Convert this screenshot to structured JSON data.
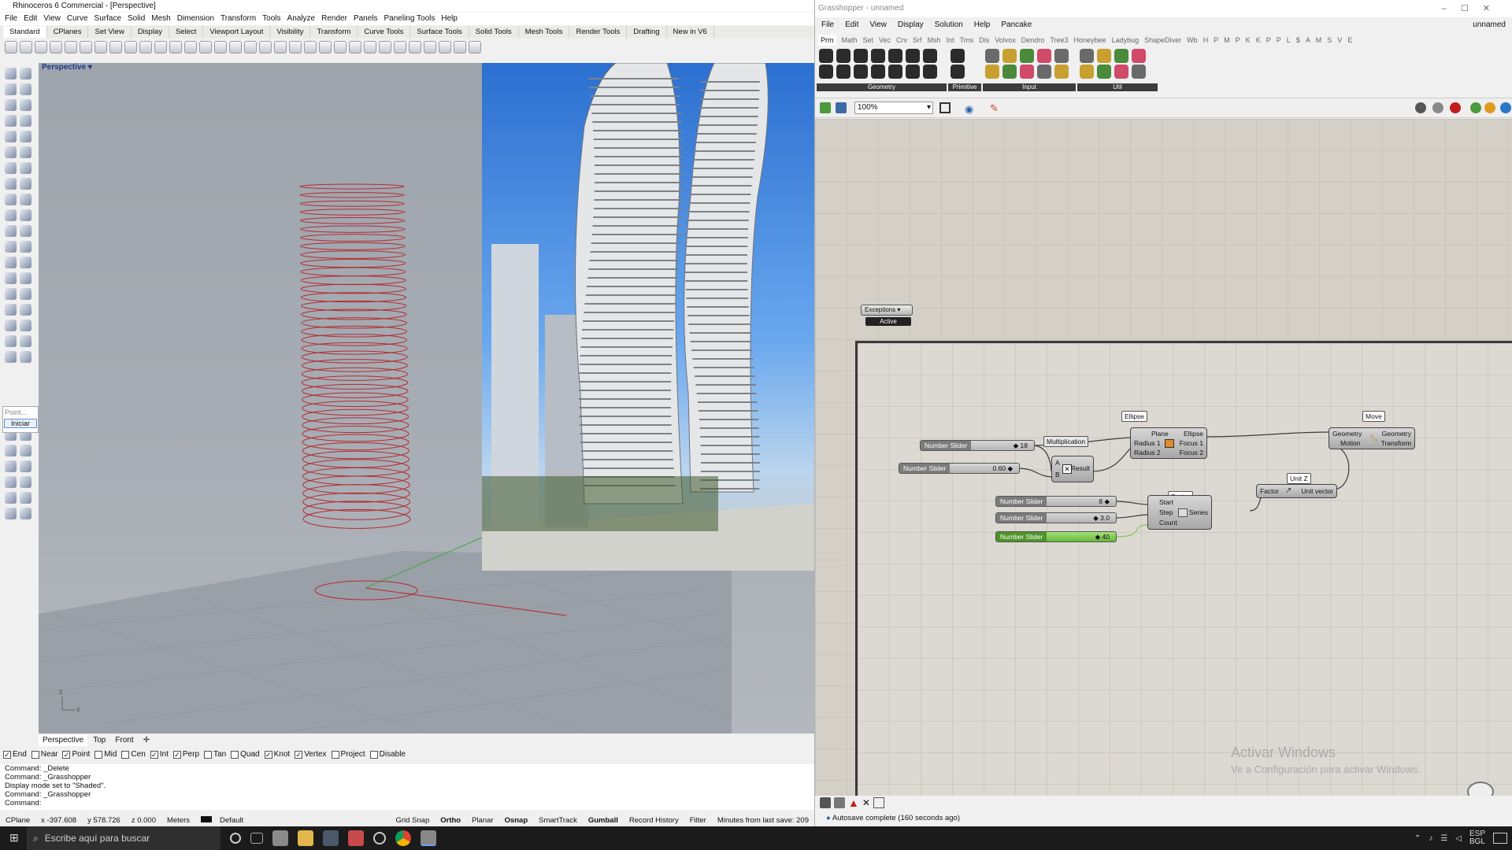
{
  "rhino": {
    "title": "Rhinoceros 6 Commercial - [Perspective]",
    "menus": [
      "File",
      "Edit",
      "View",
      "Curve",
      "Surface",
      "Solid",
      "Mesh",
      "Dimension",
      "Transform",
      "Tools",
      "Analyze",
      "Render",
      "Panels",
      "Paneling Tools",
      "Help"
    ],
    "tabs": [
      "Standard",
      "CPlanes",
      "Set View",
      "Display",
      "Select",
      "Viewport Layout",
      "Visibility",
      "Transform",
      "Curve Tools",
      "Surface Tools",
      "Solid Tools",
      "Mesh Tools",
      "Render Tools",
      "Drafting",
      "New in V6"
    ],
    "viewport_label": "Perspective",
    "viewport_tabs": [
      "Perspective",
      "Top",
      "Front"
    ],
    "side_popup": [
      "Point...",
      "Iniciar"
    ],
    "osnaps": [
      {
        "label": "End",
        "checked": true
      },
      {
        "label": "Near",
        "checked": false
      },
      {
        "label": "Point",
        "checked": true
      },
      {
        "label": "Mid",
        "checked": false
      },
      {
        "label": "Cen",
        "checked": false
      },
      {
        "label": "Int",
        "checked": true
      },
      {
        "label": "Perp",
        "checked": true
      },
      {
        "label": "Tan",
        "checked": false
      },
      {
        "label": "Quad",
        "checked": false
      },
      {
        "label": "Knot",
        "checked": true
      },
      {
        "label": "Vertex",
        "checked": true
      },
      {
        "label": "Project",
        "checked": false
      },
      {
        "label": "Disable",
        "checked": false
      }
    ],
    "command_history": [
      "Command: _Delete",
      "Command: _Grasshopper",
      "Display mode set to \"Shaded\".",
      "Command: _Grasshopper",
      "Command:"
    ],
    "status": {
      "cplane": "CPlane",
      "x": "x -397.608",
      "y": "y 578.726",
      "z": "z 0.000",
      "units": "Meters",
      "layer": "Default",
      "toggles": [
        "Grid Snap",
        "Ortho",
        "Planar",
        "Osnap",
        "SmartTrack",
        "Gumball",
        "Record History",
        "Filter"
      ],
      "save": "Minutes from last save: 209"
    }
  },
  "gh": {
    "title": "Grasshopper - unnamed",
    "menus": [
      "File",
      "Edit",
      "View",
      "Display",
      "Solution",
      "Help",
      "Pancake"
    ],
    "doc_name": "unnamed",
    "tabs": [
      "Prm",
      "Math",
      "Set",
      "Vec",
      "Crv",
      "Srf",
      "Msh",
      "Int",
      "Trns",
      "Dis",
      "Volvox",
      "Dendro",
      "Tree3",
      "Honeybee",
      "Ladybug",
      "ShapeDiver",
      "Wb",
      "H",
      "P",
      "M",
      "P",
      "K",
      "K",
      "P",
      "P",
      "L",
      "$",
      "A",
      "M",
      "S",
      "V",
      "E"
    ],
    "ribbon_groups": [
      "Geometry",
      "Primitive",
      "Input",
      "Util"
    ],
    "zoom": "100%",
    "exceptions": {
      "label": "Exceptions",
      "state": "Active"
    },
    "sliders": [
      {
        "name": "Number Slider",
        "value": "18"
      },
      {
        "name": "Number Slider",
        "value": "0.60"
      },
      {
        "name": "Number Slider",
        "value": "8"
      },
      {
        "name": "Number Slider",
        "value": "3.0"
      },
      {
        "name": "Number Slider",
        "value": "40"
      }
    ],
    "components": {
      "multiplication": {
        "tag": "Multiplication",
        "inputs": [
          "A",
          "B"
        ],
        "output": "Result"
      },
      "ellipse": {
        "tag": "Ellipse",
        "inputs": [
          "Plane",
          "Radius 1",
          "Radius 2"
        ],
        "outputs": [
          "Ellipse",
          "Focus 1",
          "Focus 2"
        ]
      },
      "move": {
        "tag": "Move",
        "inputs": [
          "Geometry",
          "Motion"
        ],
        "outputs": [
          "Geometry",
          "Transform"
        ]
      },
      "series": {
        "tag": "Series",
        "inputs": [
          "Start",
          "Step",
          "Count"
        ],
        "output": "Series"
      },
      "unitz": {
        "tag": "Unit Z",
        "input": "Factor",
        "output": "Unit vector"
      }
    },
    "watermark": {
      "title": "Activar Windows",
      "subtitle": "Ve a Configuración para activar Windows."
    },
    "status": "Autosave complete (160 seconds ago)"
  },
  "taskbar": {
    "search": "Escribe aquí para buscar",
    "lang": "ESP",
    "region": "BGL"
  }
}
